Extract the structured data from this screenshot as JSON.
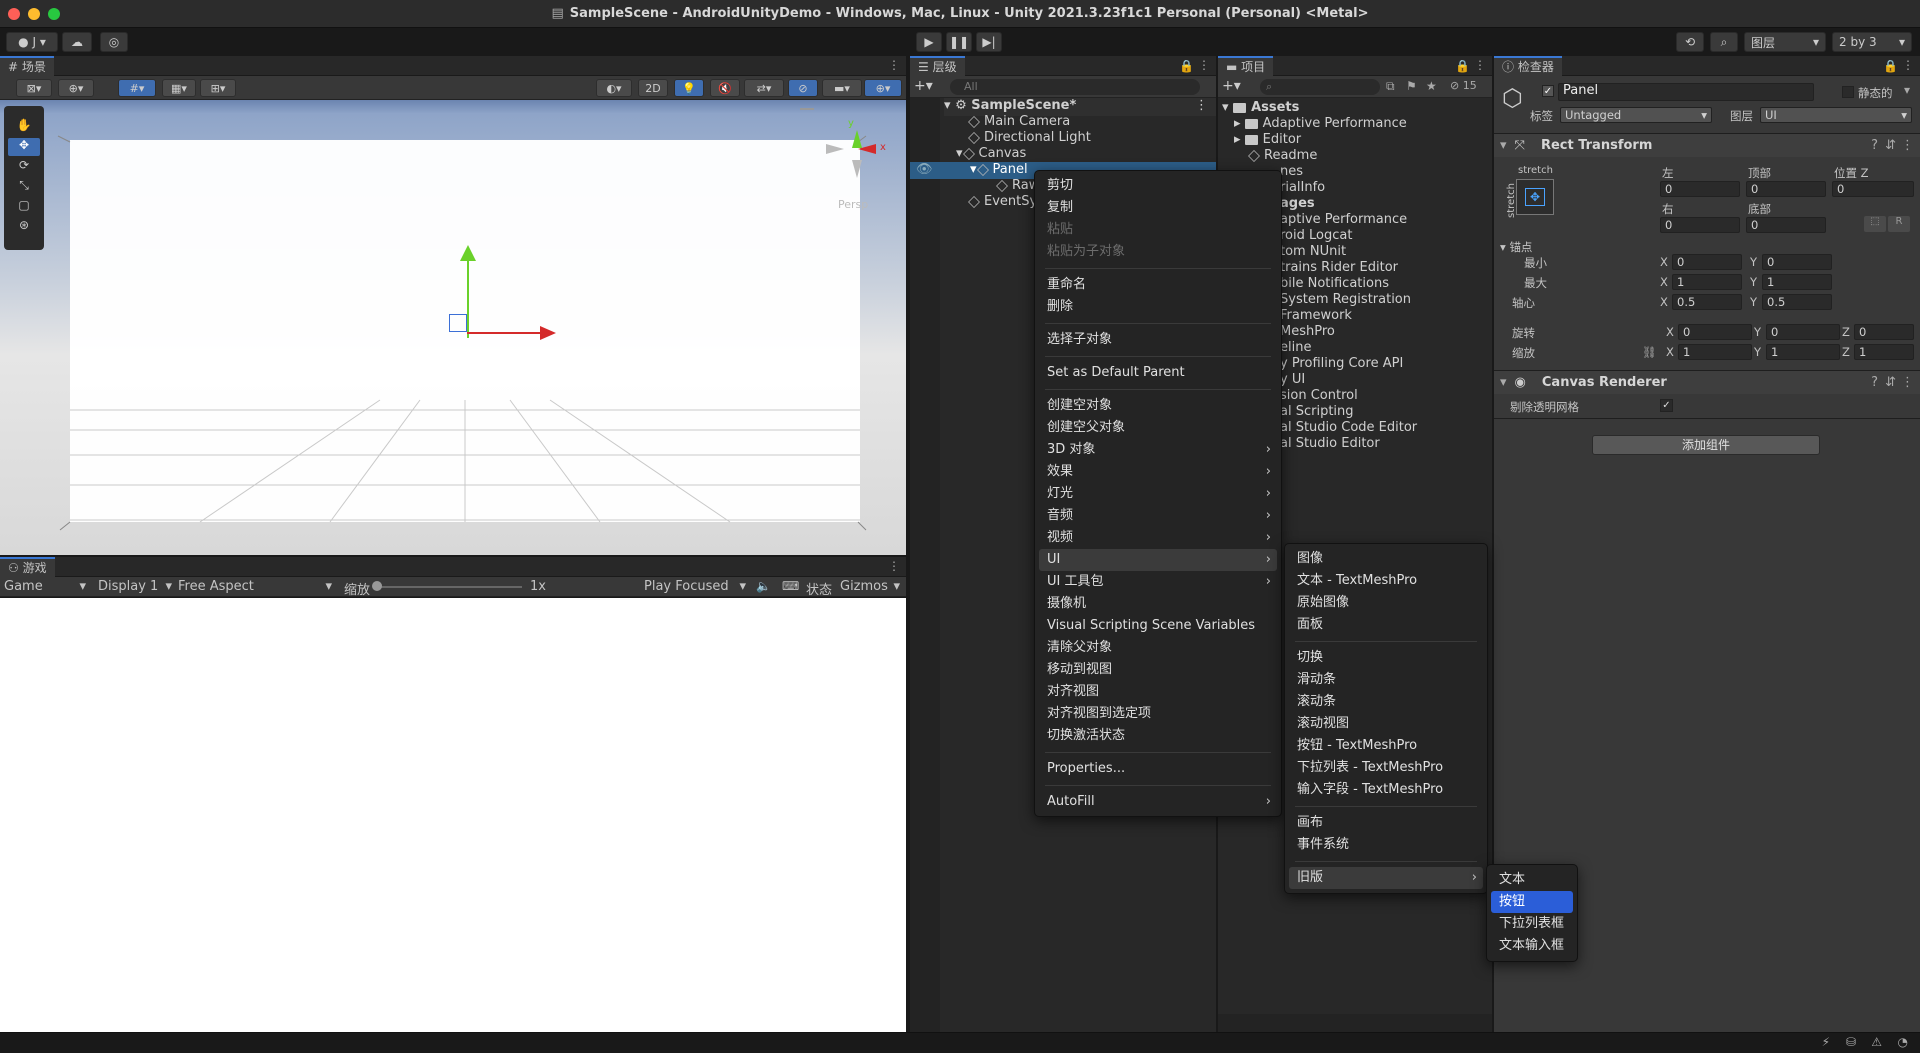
{
  "window": {
    "title": "SampleScene - AndroidUnityDemo - Windows, Mac, Linux - Unity 2021.3.23f1c1 Personal (Personal) <Metal>"
  },
  "toolbar": {
    "account": "J",
    "layers": "图层",
    "layout": "2 by 3"
  },
  "scene": {
    "tab": "场景",
    "btn2d": "2D",
    "persp": "Persp",
    "gizmo_x": "x",
    "gizmo_y": "y"
  },
  "game": {
    "tab": "游戏",
    "display_mode": "Game",
    "display": "Display 1",
    "aspect": "Free Aspect",
    "scale_label": "缩放",
    "scale_value": "1x",
    "play_mode": "Play Focused",
    "stats": "状态",
    "gizmos": "Gizmos"
  },
  "hierarchy": {
    "tab": "层级",
    "search_placeholder": "All",
    "scene_name": "SampleScene*",
    "items": [
      "Main Camera",
      "Directional Light",
      "Canvas",
      "Panel",
      "Raw",
      "EventSy"
    ]
  },
  "project": {
    "tab": "项目",
    "count": "15",
    "root": "Assets",
    "asset_folders": [
      "Adaptive Performance",
      "Editor"
    ],
    "readme": "Readme",
    "packages_visible": [
      "nes",
      "rialInfo",
      "ages",
      "aptive Performance",
      "roid Logcat",
      "tom NUnit",
      "trains Rider Editor",
      "bile Notifications",
      "System Registration",
      "Framework",
      "MeshPro",
      "eline",
      "y Profiling Core API",
      "y UI",
      "sion Control",
      "al Scripting",
      "al Studio Code Editor",
      "al Studio Editor"
    ]
  },
  "inspector": {
    "tab": "检查器",
    "object_name": "Panel",
    "static_label": "静态的",
    "tag_label": "标签",
    "tag_value": "Untagged",
    "layer_label": "图层",
    "layer_value": "UI",
    "rect_transform": {
      "title": "Rect Transform",
      "stretch": "stretch",
      "left_label": "左",
      "left": "0",
      "top_label": "顶部",
      "top": "0",
      "posz_label": "位置 Z",
      "posz": "0",
      "right_label": "右",
      "right": "0",
      "bottom_label": "底部",
      "bottom": "0",
      "anchors_label": "锚点",
      "min_label": "最小",
      "min_x": "0",
      "min_y": "0",
      "max_label": "最大",
      "max_x": "1",
      "max_y": "1",
      "pivot_label": "轴心",
      "pivot_x": "0.5",
      "pivot_y": "0.5",
      "rotation_label": "旋转",
      "rot_x": "0",
      "rot_y": "0",
      "rot_z": "0",
      "scale_label": "缩放",
      "scale_x": "1",
      "scale_y": "1",
      "scale_z": "1",
      "r_btn": "R"
    },
    "canvas_renderer": {
      "title": "Canvas Renderer",
      "cull_label": "剔除透明网格"
    },
    "add_component": "添加组件"
  },
  "context_menu": {
    "items": [
      {
        "label": "剪切"
      },
      {
        "label": "复制"
      },
      {
        "label": "粘贴",
        "disabled": true
      },
      {
        "label": "粘贴为子对象",
        "disabled": true
      },
      {
        "label": "重命名"
      },
      {
        "label": "删除"
      },
      {
        "label": "选择子对象"
      },
      {
        "label": "Set as Default Parent"
      },
      {
        "label": "创建空对象"
      },
      {
        "label": "创建空父对象"
      },
      {
        "label": "3D 对象"
      },
      {
        "label": "效果"
      },
      {
        "label": "灯光"
      },
      {
        "label": "音频"
      },
      {
        "label": "视频"
      },
      {
        "label": "UI"
      },
      {
        "label": "UI 工具包"
      },
      {
        "label": "摄像机"
      },
      {
        "label": "Visual Scripting Scene Variables"
      },
      {
        "label": "清除父对象"
      },
      {
        "label": "移动到视图"
      },
      {
        "label": "对齐视图"
      },
      {
        "label": "对齐视图到选定项"
      },
      {
        "label": "切换激活状态"
      },
      {
        "label": "Properties..."
      },
      {
        "label": "AutoFill"
      }
    ]
  },
  "ui_submenu": {
    "items": [
      "图像",
      "文本 - TextMeshPro",
      "原始图像",
      "面板",
      "切换",
      "滑动条",
      "滚动条",
      "滚动视图",
      "按钮 - TextMeshPro",
      "下拉列表 - TextMeshPro",
      "输入字段 - TextMeshPro",
      "画布",
      "事件系统",
      "旧版"
    ]
  },
  "legacy_submenu": {
    "items": [
      "文本",
      "按钮",
      "下拉列表框",
      "文本输入框"
    ]
  },
  "colors": {
    "accent": "#2b5ed8",
    "selection": "#2c5d87",
    "gizmo_x": "#d42a2a",
    "gizmo_y": "#6ad12a"
  }
}
